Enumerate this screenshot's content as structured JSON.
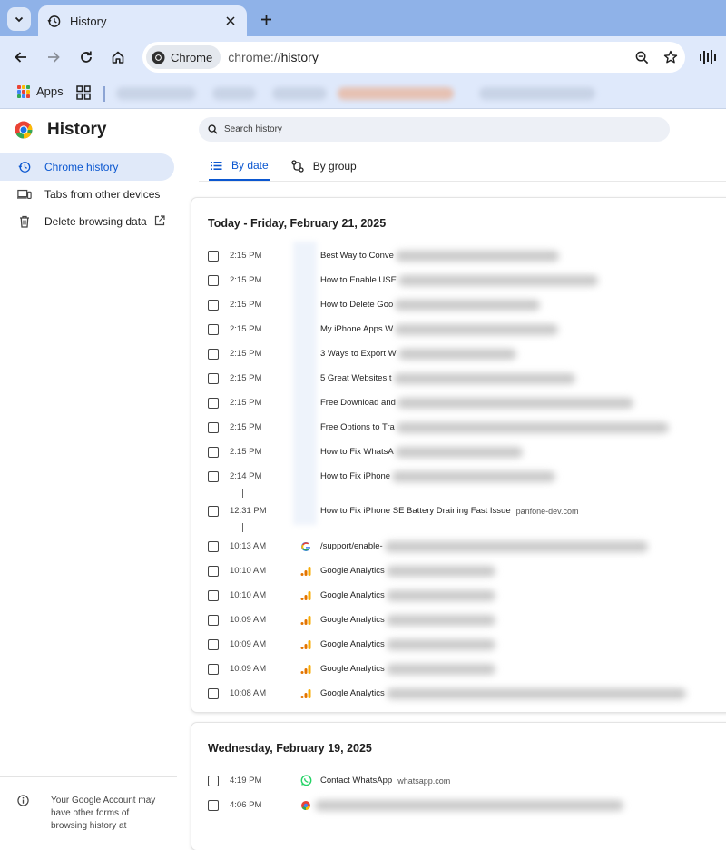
{
  "browser": {
    "tab_title": "History",
    "chip_label": "Chrome",
    "url_scheme": "chrome://",
    "url_path": "history",
    "bookmarks": {
      "apps_label": "Apps"
    }
  },
  "sidebar": {
    "title": "History",
    "items": [
      {
        "label": "Chrome history",
        "icon": "history-icon",
        "active": true
      },
      {
        "label": "Tabs from other devices",
        "icon": "devices-icon",
        "active": false
      },
      {
        "label": "Delete browsing data",
        "icon": "trash-icon",
        "active": false
      }
    ],
    "footer_text": "Your Google Account may have other forms of browsing history at"
  },
  "main": {
    "search_placeholder": "Search history",
    "view_tabs": [
      {
        "label": "By date",
        "active": true
      },
      {
        "label": "By group",
        "active": false
      }
    ],
    "days": [
      {
        "heading": "Today - Friday, February 21, 2025",
        "entries": [
          {
            "time": "2:15 PM",
            "title": "Best Way to Conve",
            "domain": "",
            "favicon": ""
          },
          {
            "time": "2:15 PM",
            "title": "How to Enable USE",
            "domain": "",
            "favicon": ""
          },
          {
            "time": "2:15 PM",
            "title": "How to Delete Goo",
            "domain": "",
            "favicon": ""
          },
          {
            "time": "2:15 PM",
            "title": "My iPhone Apps W",
            "domain": "",
            "favicon": ""
          },
          {
            "time": "2:15 PM",
            "title": "3 Ways to Export W",
            "domain": "",
            "favicon": ""
          },
          {
            "time": "2:15 PM",
            "title": "5 Great Websites t",
            "domain": "",
            "favicon": ""
          },
          {
            "time": "2:15 PM",
            "title": "Free Download and",
            "domain": "",
            "favicon": ""
          },
          {
            "time": "2:15 PM",
            "title": "Free Options to Tra",
            "domain": "",
            "favicon": ""
          },
          {
            "time": "2:15 PM",
            "title": "How to Fix WhatsA",
            "domain": "",
            "favicon": ""
          },
          {
            "time": "2:14 PM",
            "title": "How to Fix iPhone",
            "domain": "",
            "favicon": ""
          },
          {
            "time": "12:31 PM",
            "title": "How to Fix iPhone SE Battery Draining Fast Issue",
            "domain": "panfone-dev.com",
            "favicon": ""
          },
          {
            "time": "10:13 AM",
            "title": "/support/enable-",
            "domain": "",
            "favicon": "google-icon"
          },
          {
            "time": "10:10 AM",
            "title": "Google Analytics",
            "domain": "",
            "favicon": "analytics-icon"
          },
          {
            "time": "10:10 AM",
            "title": "Google Analytics",
            "domain": "",
            "favicon": "analytics-icon"
          },
          {
            "time": "10:09 AM",
            "title": "Google Analytics",
            "domain": "",
            "favicon": "analytics-icon"
          },
          {
            "time": "10:09 AM",
            "title": "Google Analytics",
            "domain": "",
            "favicon": "analytics-icon"
          },
          {
            "time": "10:09 AM",
            "title": "Google Analytics",
            "domain": "",
            "favicon": "analytics-icon"
          },
          {
            "time": "10:08 AM",
            "title": "Google Analytics",
            "domain": "",
            "favicon": "analytics-icon"
          }
        ]
      },
      {
        "heading": "Wednesday, February 19, 2025",
        "entries": [
          {
            "time": "4:19 PM",
            "title": "Contact WhatsApp",
            "domain": "whatsapp.com",
            "favicon": "whatsapp-icon"
          },
          {
            "time": "4:06 PM",
            "title": "",
            "domain": "",
            "favicon": "chrome-small-icon"
          }
        ]
      }
    ]
  },
  "colors": {
    "tabstrip": "#8fb2e8",
    "toolbar": "#dfe9fb",
    "accent": "#0b57d0",
    "active_nav_bg": "#e0e9f9"
  }
}
